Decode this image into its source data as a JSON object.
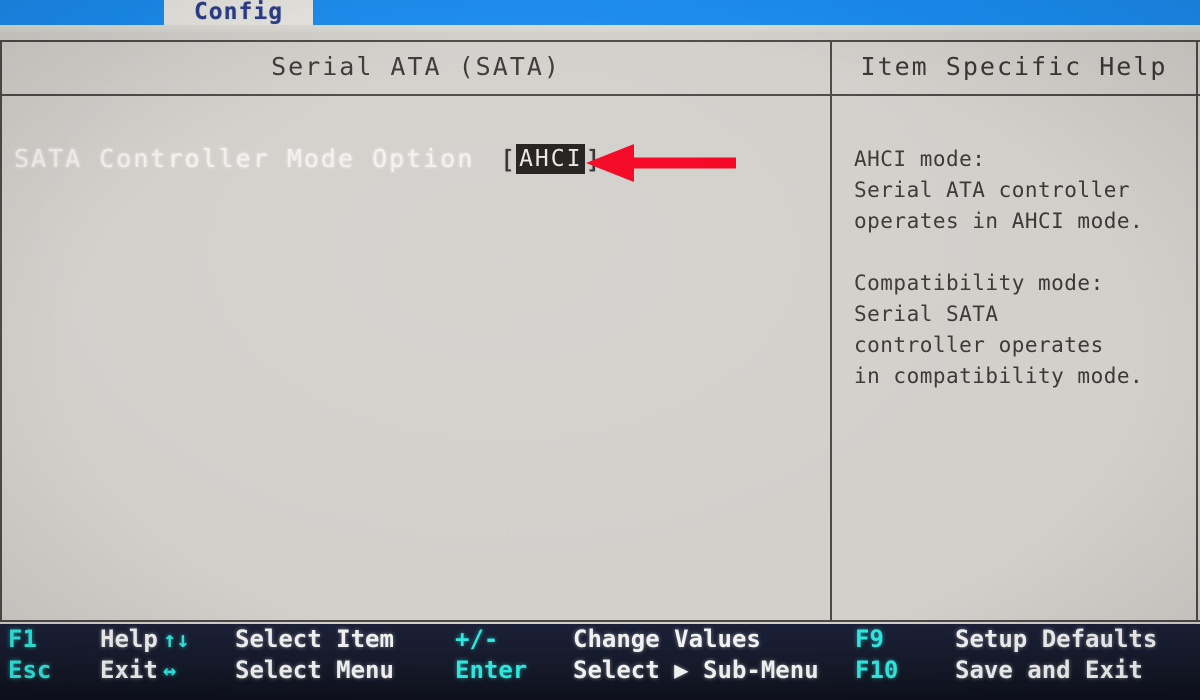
{
  "menu": {
    "active_tab": "Config"
  },
  "panels": {
    "main_title": "Serial ATA (SATA)",
    "help_title": "Item Specific Help"
  },
  "setting": {
    "label": "SATA Controller Mode Option",
    "bracket_open": "[",
    "bracket_close": "]",
    "value": "AHCI"
  },
  "help": {
    "paragraphs": [
      {
        "lines": [
          "AHCI mode:",
          "Serial ATA controller",
          "operates in AHCI mode."
        ]
      },
      {
        "lines": [
          "Compatibility mode:",
          "Serial SATA",
          "controller operates",
          "in compatibility mode."
        ]
      }
    ]
  },
  "statusbar": {
    "groups": [
      {
        "name": "keys",
        "rows": [
          {
            "key": "F1",
            "desc": "Help"
          },
          {
            "key": "Esc",
            "desc": "Exit"
          }
        ]
      },
      {
        "name": "navigation",
        "rows": [
          {
            "key": "↑↓",
            "desc": "Select Item"
          },
          {
            "key": "↔",
            "desc": "Select Menu"
          }
        ]
      },
      {
        "name": "values",
        "rows": [
          {
            "key": "+/-",
            "desc": "Change Values"
          },
          {
            "key": "Enter",
            "desc": "Select ▶ Sub-Menu"
          }
        ]
      },
      {
        "name": "function",
        "rows": [
          {
            "key": "F9",
            "desc": "Setup Defaults"
          },
          {
            "key": "F10",
            "desc": "Save and Exit"
          }
        ]
      }
    ]
  },
  "annotation": {
    "arrow_color": "#f5001e",
    "arrow_direction": "left",
    "points_at": "SATA Controller Mode Option value"
  },
  "colors": {
    "menubar_blue": "#1a8cf0",
    "tab_text": "#2a3c87",
    "screen_background": "#d2d0cb",
    "frame_line": "#4c4a47",
    "status_background": "#161a2e",
    "status_key": "#2fe8e0",
    "status_text": "#f2f2f2",
    "value_highlight_bg": "#1d1b1a",
    "value_highlight_text": "#e9e8e5"
  }
}
